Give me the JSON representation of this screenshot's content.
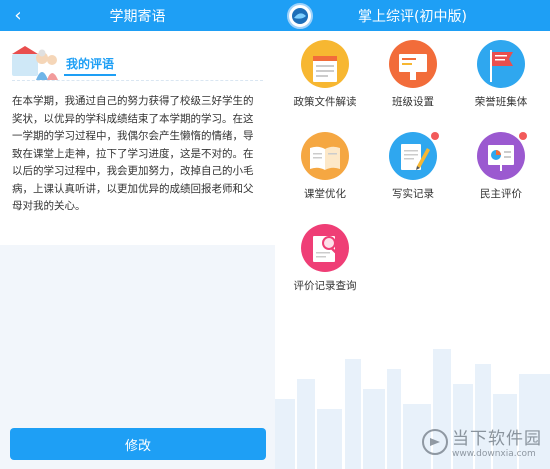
{
  "left": {
    "header_title": "学期寄语",
    "back_glyph": "‹",
    "comment_title": "我的评语",
    "comment_text": "在本学期，我通过自己的努力获得了校级三好学生的奖状，以优异的学科成绩结束了本学期的学习。在这一学期的学习过程中，我偶尔会产生懒惰的情绪，导致在课堂上走神，拉下了学习进度，这是不对的。在以后的学习过程中，我会更加努力，改掉自己的小毛病，上课认真听讲，以更加优异的成绩回报老师和父母对我的关心。",
    "edit_button": "修改"
  },
  "right": {
    "header_title": "掌上综评(初中版)",
    "tiles": [
      {
        "label": "政策文件解读",
        "color": "#f7b731",
        "icon": "document-icon"
      },
      {
        "label": "班级设置",
        "color": "#f26c3a",
        "icon": "blackboard-icon"
      },
      {
        "label": "荣誉班集体",
        "color": "#2fa7ef",
        "icon": "flag-icon"
      },
      {
        "label": "课堂优化",
        "color": "#f5a742",
        "icon": "book-icon"
      },
      {
        "label": "写实记录",
        "color": "#2fa7ef",
        "icon": "notebook-pen-icon"
      },
      {
        "label": "民主评价",
        "color": "#9b59d0",
        "icon": "chart-board-icon"
      },
      {
        "label": "评价记录查询",
        "color": "#ef3e76",
        "icon": "search-document-icon"
      }
    ],
    "watermark_cn": "当下软件园",
    "watermark_url": "www.downxia.com"
  }
}
